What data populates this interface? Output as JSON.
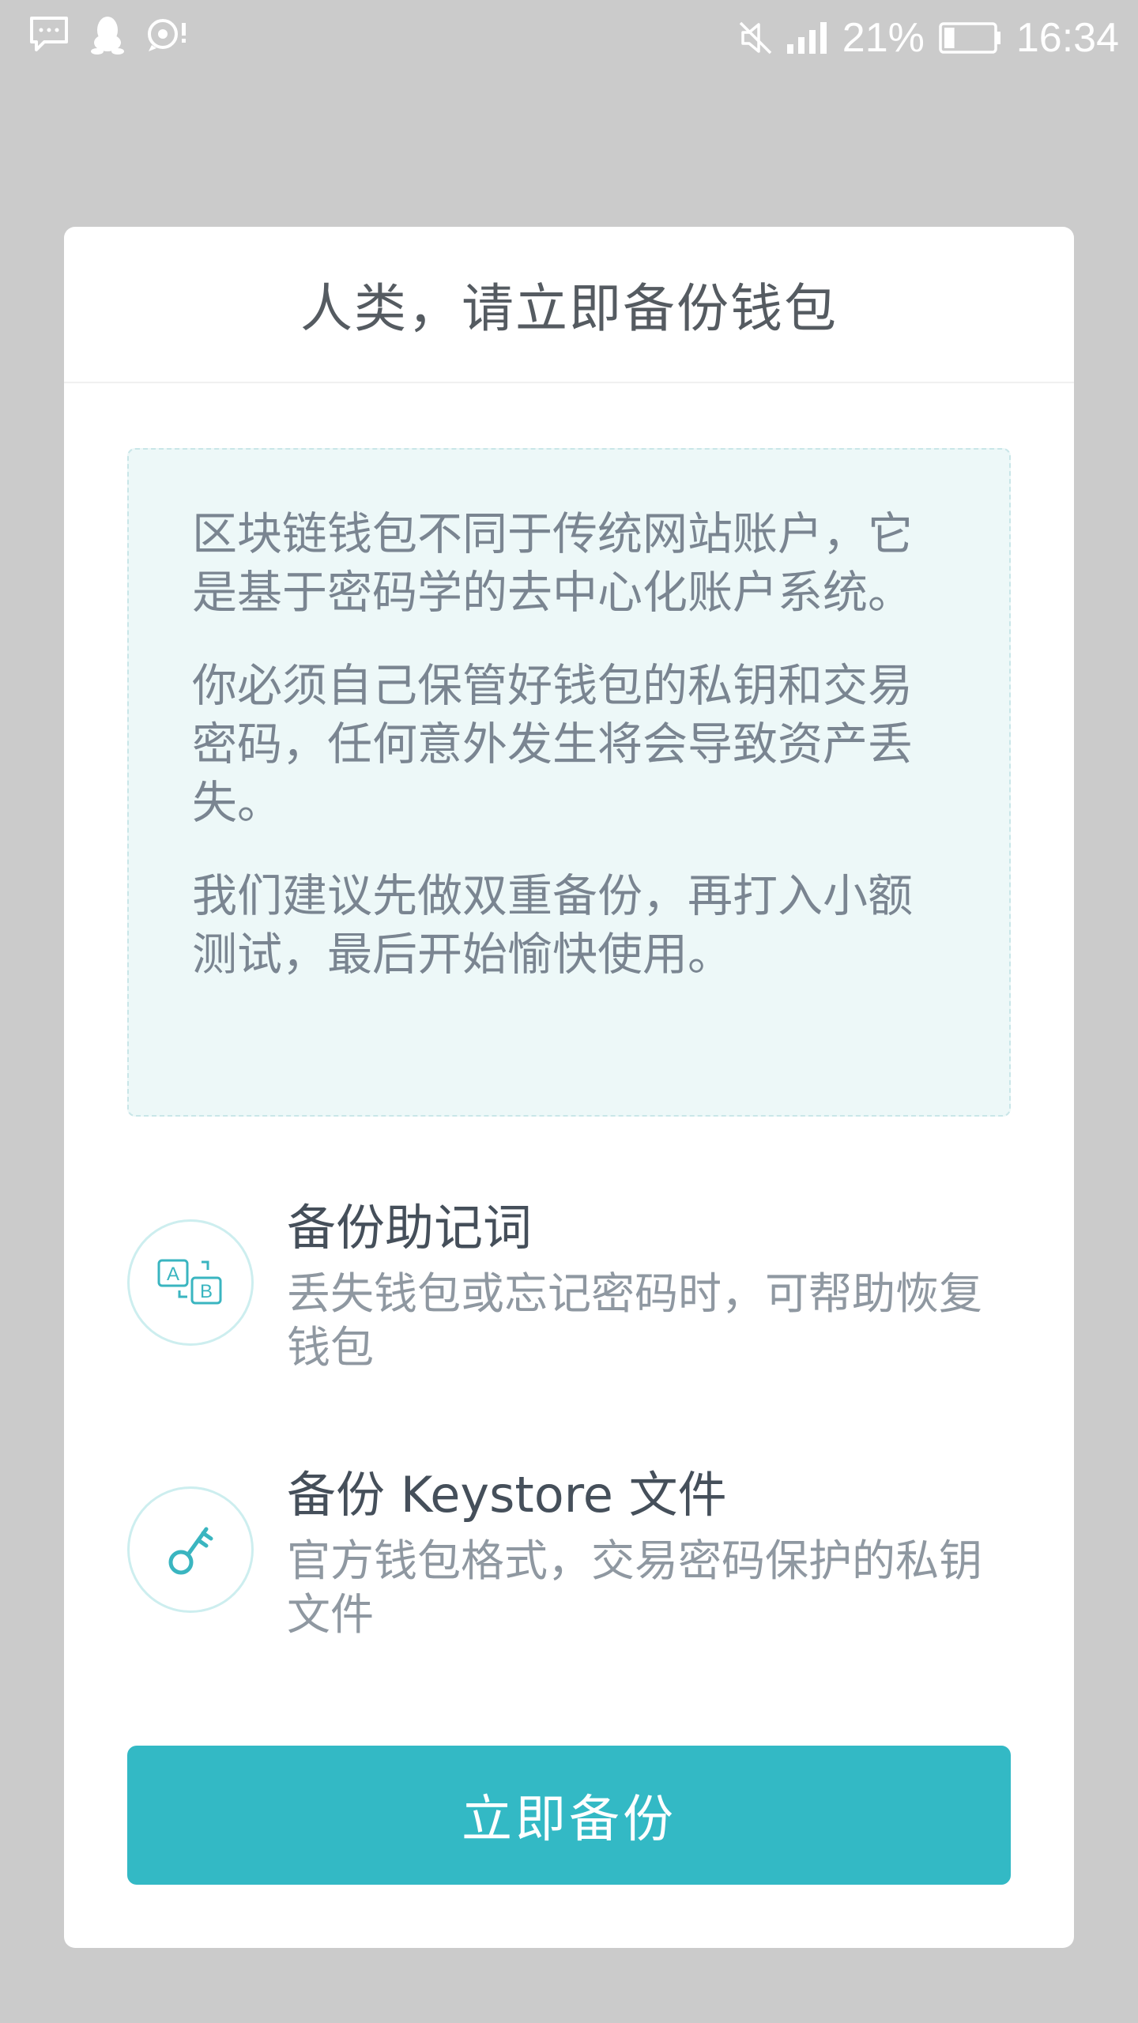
{
  "status_bar": {
    "battery_percent": "21%",
    "battery_level": 0.21,
    "time": "16:34",
    "icons": [
      "chat-bubble-icon",
      "qq-penguin-icon",
      "message-notification-icon",
      "mute-icon",
      "signal-icon",
      "battery-icon"
    ],
    "icon_color": "#ffffff"
  },
  "dialog": {
    "title": "人类，请立即备份钱包",
    "info": {
      "paragraphs": [
        "区块链钱包不同于传统网站账户，它是基于密码学的去中心化账户系统。",
        "你必须自己保管好钱包的私钥和交易密码，任何意外发生将会导致资产丢失。",
        "我们建议先做双重备份，再打入小额测试，最后开始愉快使用。"
      ]
    },
    "options": [
      {
        "icon": "mnemonic-ab-icon",
        "title": "备份助记词",
        "description": "丢失钱包或忘记密码时，可帮助恢复钱包"
      },
      {
        "icon": "key-icon",
        "title": "备份 Keystore 文件",
        "description": "官方钱包格式，交易密码保护的私钥文件"
      }
    ],
    "primary_button": "立即备份"
  },
  "colors": {
    "overlay_background": "#cbcbcb",
    "accent": "#33b9c5",
    "info_background": "#edf8f8",
    "title_text": "#555b61",
    "body_text": "#7a8591"
  }
}
